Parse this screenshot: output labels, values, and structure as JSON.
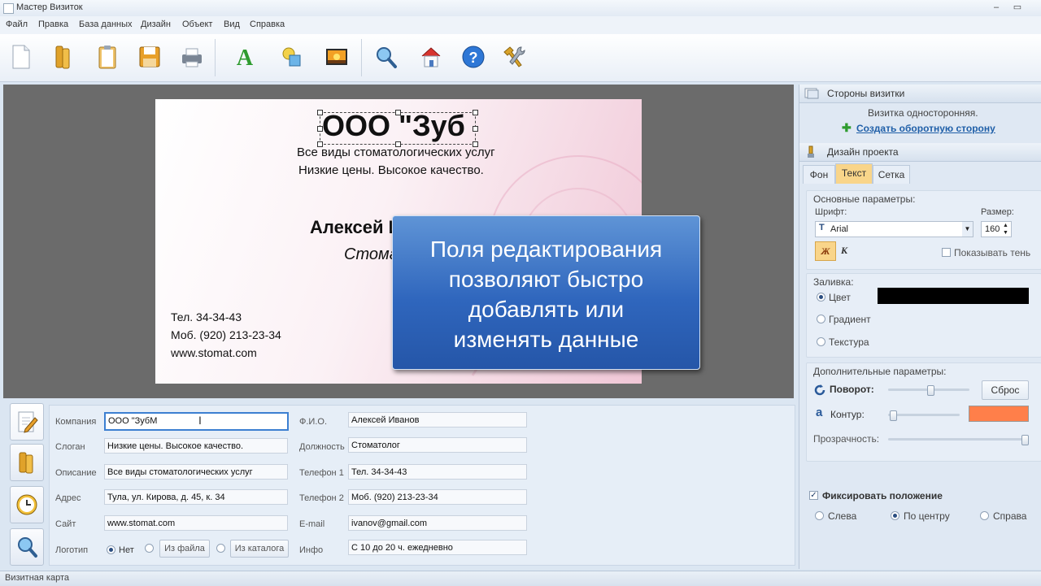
{
  "window": {
    "title": "Мастер Визиток",
    "minimize": "‒",
    "maximize": "▭"
  },
  "menu": [
    "Файл",
    "Правка",
    "База данных",
    "Дизайн",
    "Объект",
    "Вид",
    "Справка"
  ],
  "toolbar": {
    "icons": [
      "new-document-icon",
      "open-folder-icon",
      "clipboard-icon",
      "save-icon",
      "print-icon",
      "text-tool-icon",
      "shapes-tool-icon",
      "image-tool-icon",
      "zoom-icon",
      "home-icon",
      "help-icon",
      "tools-icon"
    ]
  },
  "card": {
    "company": "ООО \"Зуб",
    "description": "Все виды стоматологических услуг",
    "slogan": "Низкие цены. Высокое качество.",
    "name": "Алексей Иванов",
    "position": "Стома",
    "phone": "Тел. 34-34-43",
    "mobile": "Моб. (920) 213-23-34",
    "site": "www.stomat.com"
  },
  "callout": {
    "lines": [
      "Поля редактирования",
      "позволяют быстро",
      "добавлять или",
      "изменять данные"
    ]
  },
  "fields": {
    "company": {
      "label": "Компания",
      "value": "ООО \"ЗубМ"
    },
    "slogan": {
      "label": "Слоган",
      "value": "Низкие цены. Высокое качество."
    },
    "description": {
      "label": "Описание",
      "value": "Все виды стоматологических услуг"
    },
    "address": {
      "label": "Адрес",
      "value": "Тула, ул. Кирова, д. 45, к. 34"
    },
    "site": {
      "label": "Сайт",
      "value": "www.stomat.com"
    },
    "logo": {
      "label": "Логотип",
      "no": "Нет",
      "from_file": "Из файла",
      "from_catalog": "Из каталога"
    },
    "fio": {
      "label": "Ф.И.О.",
      "value": "Алексей Иванов"
    },
    "position": {
      "label": "Должность",
      "value": "Стоматолог"
    },
    "phone1": {
      "label": "Телефон 1",
      "value": "Тел. 34-34-43"
    },
    "phone2": {
      "label": "Телефон 2",
      "value": "Моб. (920) 213-23-34"
    },
    "email": {
      "label": "E-mail",
      "value": "ivanov@gmail.com"
    },
    "info": {
      "label": "Инфо",
      "value": "С 10 до 20 ч. ежедневно"
    }
  },
  "sides_panel": {
    "title": "Стороны визитки",
    "status": "Визитка односторонняя.",
    "create_link": "Создать оборотную сторону"
  },
  "design_panel": {
    "title": "Дизайн проекта",
    "tabs": [
      "Фон",
      "Текст",
      "Сетка"
    ],
    "active_tab": "Текст",
    "basic_params": "Основные параметры:",
    "font_label": "Шрифт:",
    "font_value": "Arial",
    "size_label": "Размер:",
    "size_value": "160",
    "bold": "Ж",
    "italic": "К",
    "shadow": "Показывать тень",
    "fill_label": "Заливка:",
    "fill_color": "Цвет",
    "fill_gradient": "Градиент",
    "fill_texture": "Текстура",
    "fill_color_value": "#000000",
    "extra_params": "Дополнительные параметры:",
    "rotation": "Поворот:",
    "reset": "Сброс",
    "outline": "Контур:",
    "outline_color_value": "#ff7f4a",
    "transparency": "Прозрачность:",
    "fix_position": "Фиксировать положение",
    "align_left": "Слева",
    "align_center": "По центру",
    "align_right": "Справа"
  },
  "statusbar": {
    "text": "Визитная карта"
  }
}
